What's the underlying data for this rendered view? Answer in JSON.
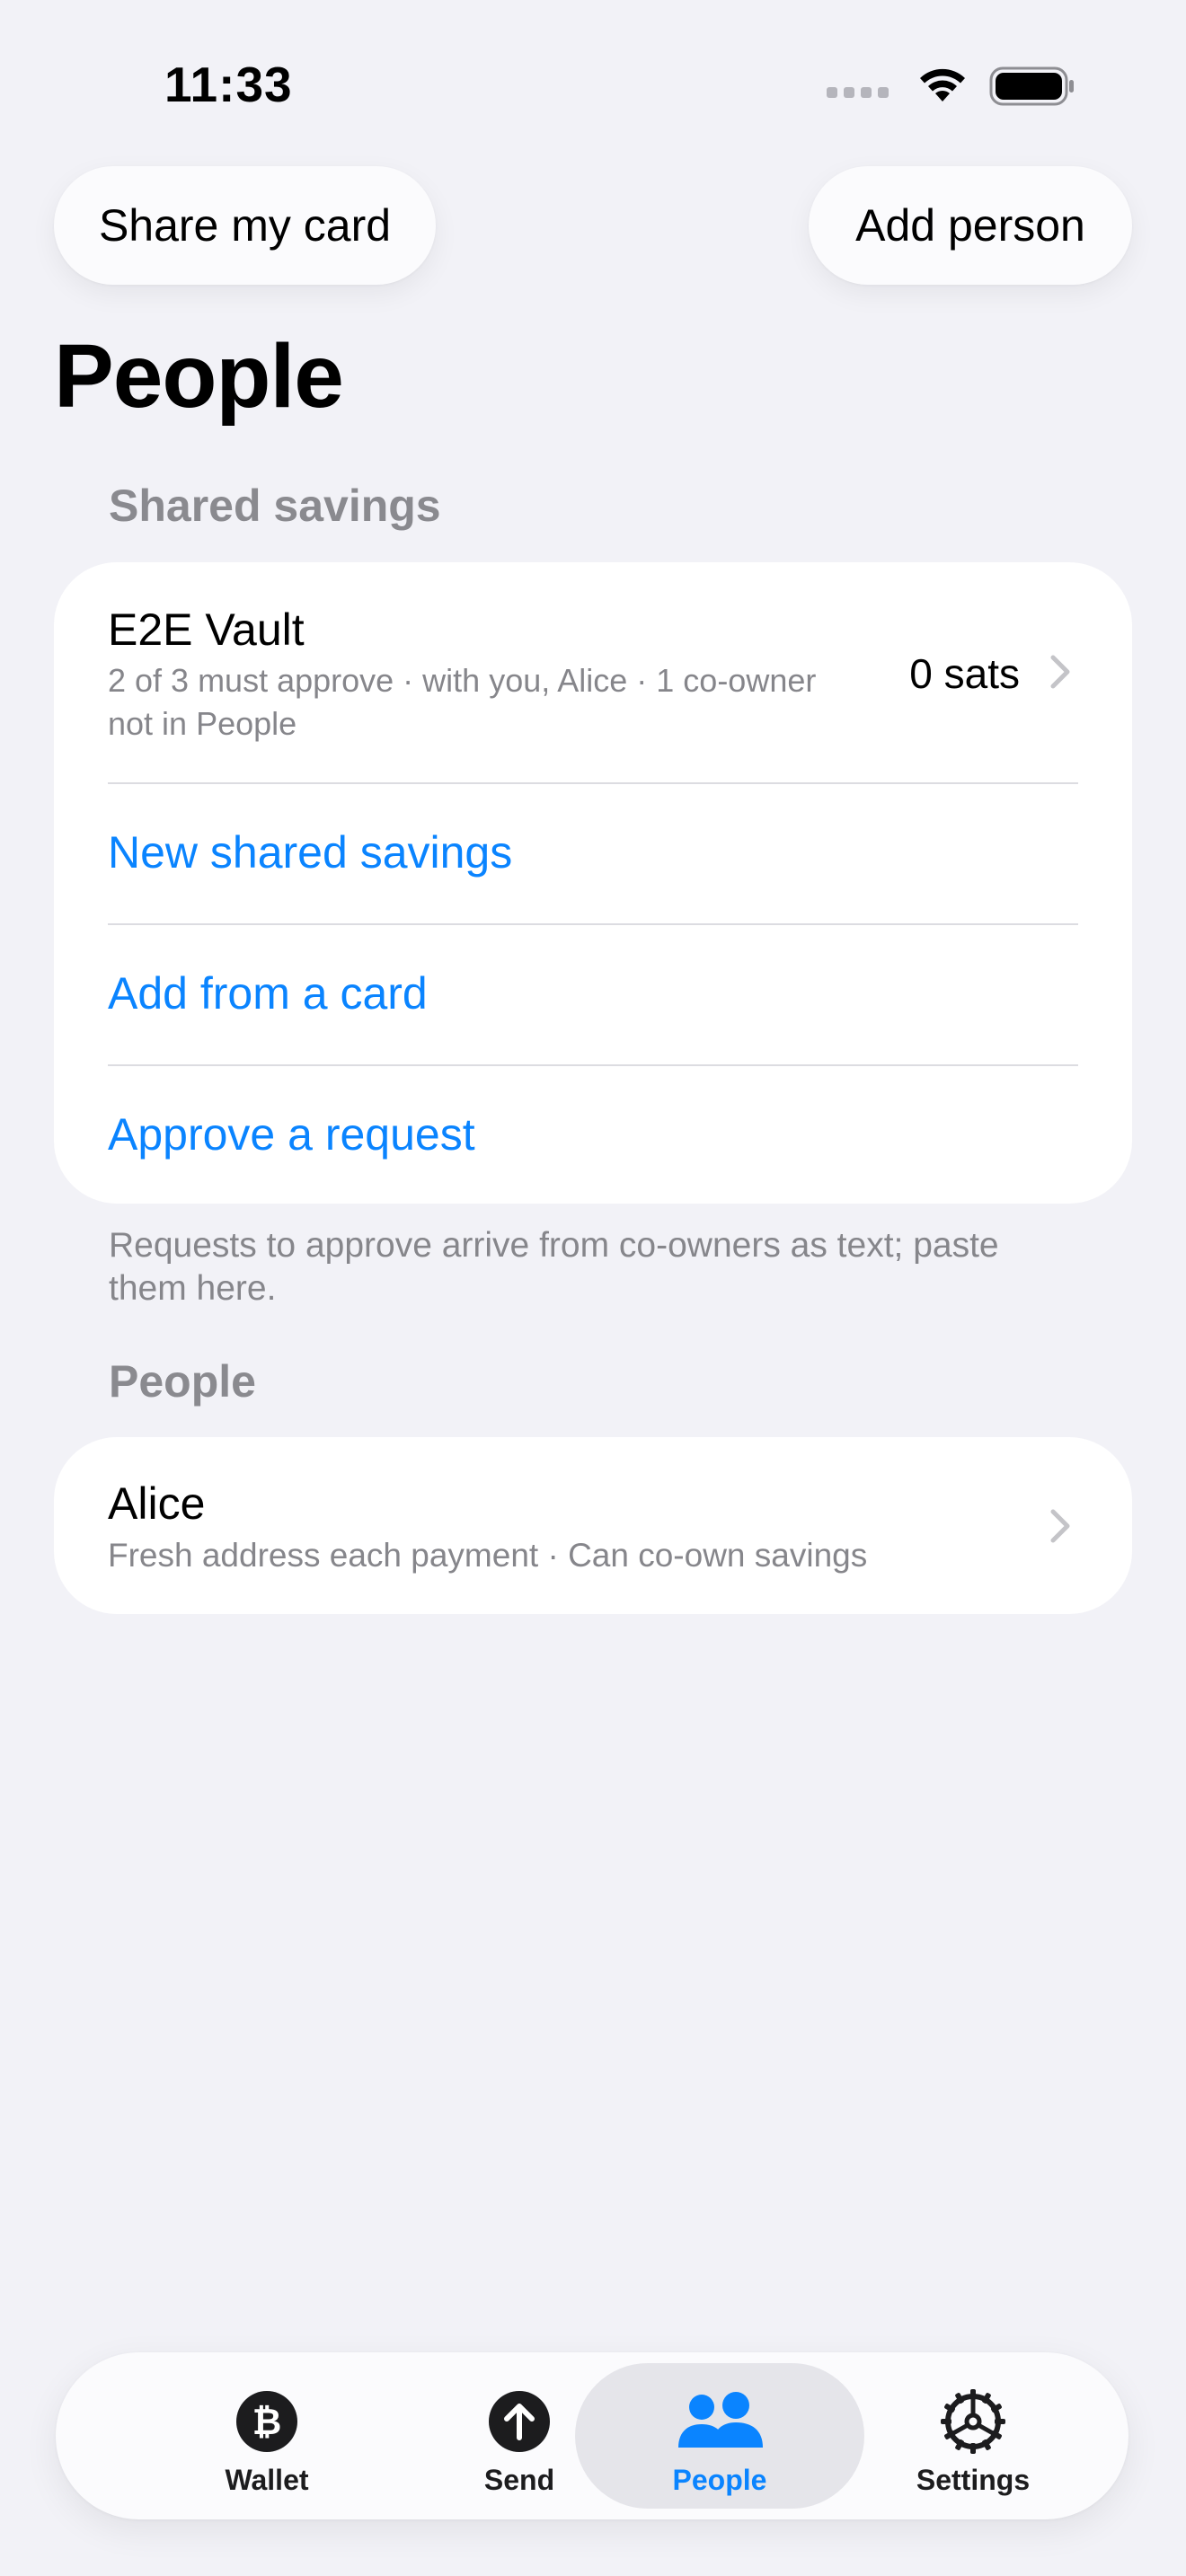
{
  "status_bar": {
    "time": "11:33"
  },
  "top_actions": {
    "share_label": "Share my card",
    "add_person_label": "Add person"
  },
  "page_title": "People",
  "shared_savings": {
    "header": "Shared savings",
    "vault": {
      "name": "E2E Vault",
      "subtitle_line1": "2 of 3 must approve · with you, Alice · 1 co-owner",
      "subtitle_line2": "not in People",
      "balance": "0 sats"
    },
    "actions": {
      "new_label": "New shared savings",
      "add_from_card_label": "Add from a card",
      "approve_label": "Approve a request"
    },
    "footer_line1": "Requests to approve arrive from co-owners as text; paste",
    "footer_line2": "them here."
  },
  "people": {
    "header": "People",
    "contacts": [
      {
        "name": "Alice",
        "subtitle": "Fresh address each payment · Can co-own savings"
      }
    ]
  },
  "tab_bar": {
    "tabs": [
      {
        "label": "Wallet",
        "icon": "bitcoin-icon"
      },
      {
        "label": "Send",
        "icon": "arrow-up-icon"
      },
      {
        "label": "People",
        "icon": "people-icon"
      },
      {
        "label": "Settings",
        "icon": "gear-icon"
      }
    ],
    "selected": "People"
  },
  "colors": {
    "background": "#f2f2f7",
    "accent": "#0a84ff",
    "secondary_text": "#86868b",
    "card": "#ffffff"
  }
}
